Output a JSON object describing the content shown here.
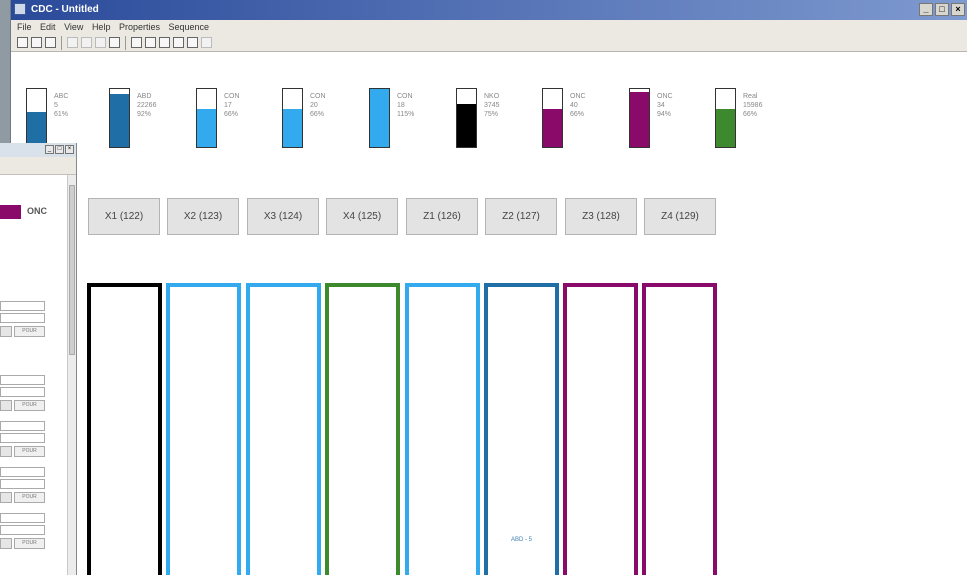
{
  "window": {
    "title": "CDC - Untitled"
  },
  "menu": [
    "File",
    "Edit",
    "View",
    "Help",
    "Properties",
    "Sequence"
  ],
  "gauges": [
    {
      "name": "ABC",
      "value": "5",
      "percent": "61%",
      "level": 0.61,
      "color": "#1f6fa6"
    },
    {
      "name": "ABD",
      "value": "22266",
      "percent": "92%",
      "level": 0.92,
      "color": "#1f6fa6"
    },
    {
      "name": "CON",
      "value": "17",
      "percent": "66%",
      "level": 0.66,
      "color": "#33aaee"
    },
    {
      "name": "CON",
      "value": "20",
      "percent": "66%",
      "level": 0.66,
      "color": "#33aaee"
    },
    {
      "name": "CON",
      "value": "18",
      "percent": "115%",
      "level": 1.0,
      "color": "#33aaee"
    },
    {
      "name": "NKO",
      "value": "3745",
      "percent": "75%",
      "level": 0.75,
      "color": "#000000"
    },
    {
      "name": "ONC",
      "value": "40",
      "percent": "66%",
      "level": 0.66,
      "color": "#8a0a6a"
    },
    {
      "name": "ONC",
      "value": "34",
      "percent": "94%",
      "level": 0.94,
      "color": "#8a0a6a"
    },
    {
      "name": "Real",
      "value": "15986",
      "percent": "66%",
      "level": 0.66,
      "color": "#3d8a2e"
    }
  ],
  "buttons": [
    "X1 (122)",
    "X2 (123)",
    "X3 (124)",
    "X4 (125)",
    "Z1 (126)",
    "Z2 (127)",
    "Z3 (128)",
    "Z4 (129)"
  ],
  "columns": [
    {
      "color": "#000000"
    },
    {
      "color": "#33aaee"
    },
    {
      "color": "#33aaee"
    },
    {
      "color": "#3d8a2e"
    },
    {
      "color": "#33aaee"
    },
    {
      "color": "#1f6fa6",
      "label": "ABD - 5"
    },
    {
      "color": "#8a0a6a"
    },
    {
      "color": "#8a0a6a"
    }
  ],
  "secondary": {
    "label": "ONC",
    "pour_label": "POUR",
    "colors": {
      "onc": "#8a0a6a"
    }
  }
}
